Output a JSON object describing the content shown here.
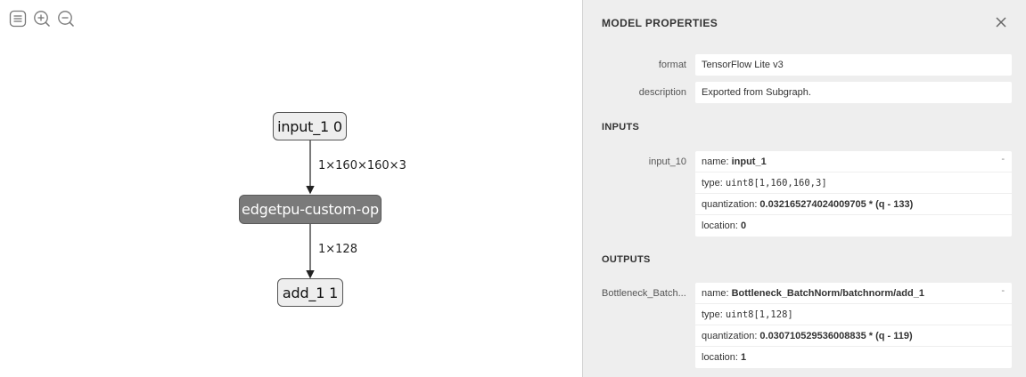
{
  "toolbar": {
    "buttons": [
      {
        "icon": "sidebar-menu-icon"
      },
      {
        "icon": "zoom-in-icon"
      },
      {
        "icon": "zoom-out-icon"
      }
    ]
  },
  "graph": {
    "nodes": {
      "input": "input_1 0",
      "op": "edgetpu-custom-op",
      "output": "add_1 1"
    },
    "edges": {
      "input_to_op": "1×160×160×3",
      "op_to_output": "1×128"
    }
  },
  "panel": {
    "title": "MODEL PROPERTIES",
    "properties": [
      {
        "label": "format",
        "value": "TensorFlow Lite v3"
      },
      {
        "label": "description",
        "value": "Exported from Subgraph."
      }
    ],
    "inputs": {
      "section": "INPUTS",
      "label": "input_10",
      "name_key": "name:",
      "name": "input_1",
      "type_key": "type:",
      "type": "uint8[1,160,160,3]",
      "quant_key": "quantization:",
      "quantization": "0.032165274024009705 * (q - 133)",
      "location_key": "location:",
      "location": "0",
      "expander": "-"
    },
    "outputs": {
      "section": "OUTPUTS",
      "label": "Bottleneck_Batch...",
      "name_key": "name:",
      "name": "Bottleneck_BatchNorm/batchnorm/add_1",
      "type_key": "type:",
      "type": "uint8[1,128]",
      "quant_key": "quantization:",
      "quantization": "0.030710529536008835 * (q - 119)",
      "location_key": "location:",
      "location": "1",
      "expander": "-"
    }
  },
  "colors": {
    "panel_bg": "#eeeeee",
    "op_node": "#7a7a7a",
    "io_node": "#eeeeee"
  }
}
